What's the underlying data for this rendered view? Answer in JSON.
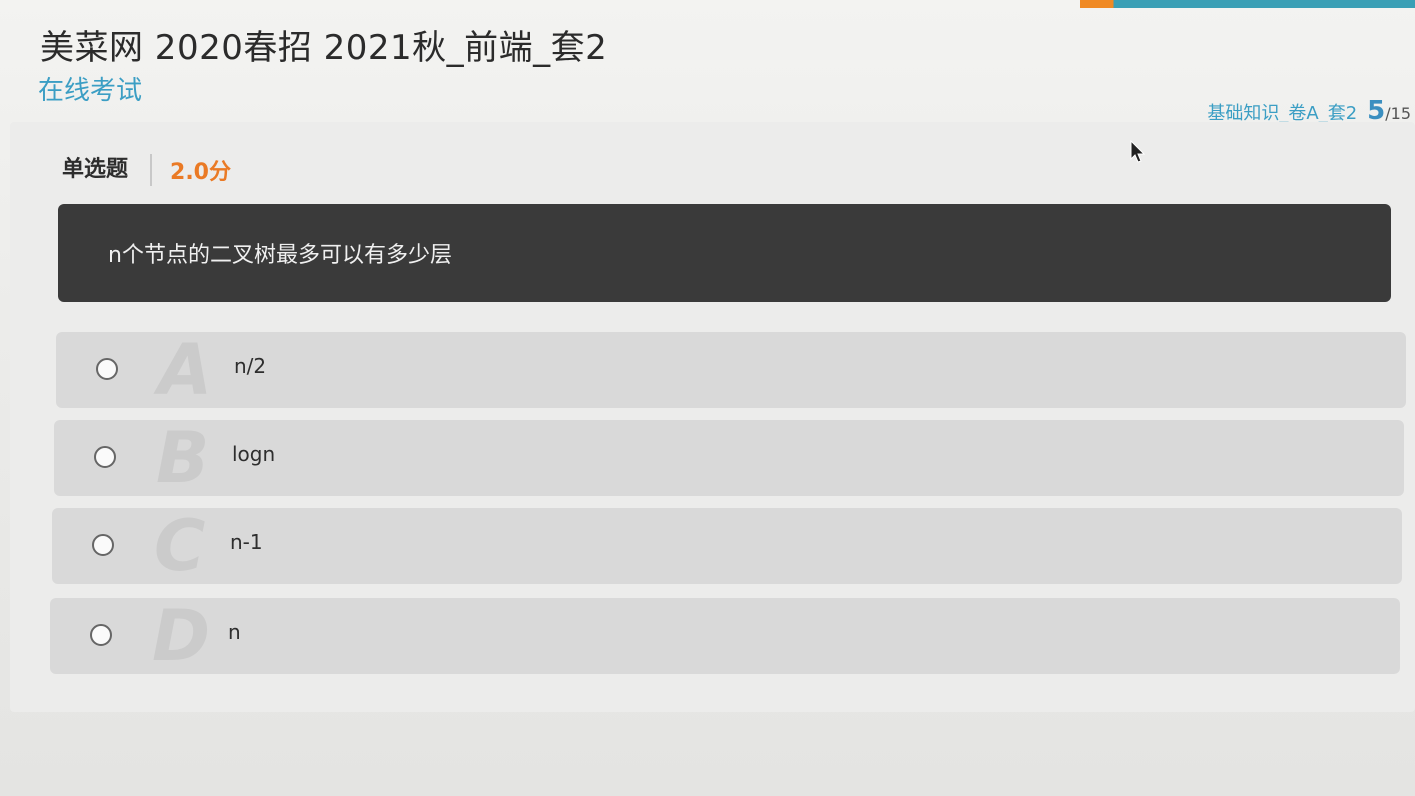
{
  "header": {
    "title": "美菜网 2020春招 2021秋_前端_套2",
    "subtitle": "在线考试"
  },
  "section": {
    "name": "基础知识_卷A_套2",
    "current": "5",
    "total": "/15"
  },
  "question": {
    "type": "单选题",
    "score": "2.0分",
    "text": "n个节点的二叉树最多可以有多少层",
    "options": [
      {
        "letter": "A",
        "text": "n/2"
      },
      {
        "letter": "B",
        "text": "logn"
      },
      {
        "letter": "C",
        "text": "n-1"
      },
      {
        "letter": "D",
        "text": "n"
      }
    ]
  },
  "colors": {
    "accent": "#3b9ec4",
    "score": "#ea7a25",
    "question_box": "#3a3a3a"
  }
}
